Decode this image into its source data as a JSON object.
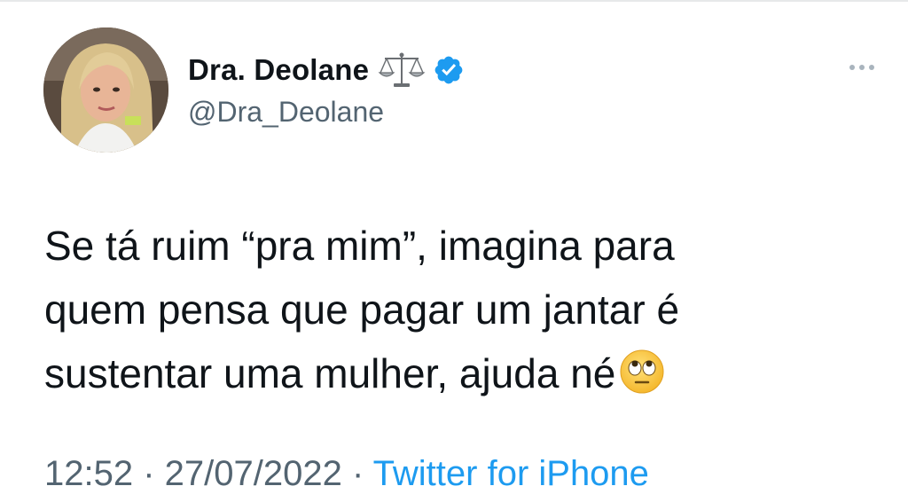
{
  "tweet": {
    "author": {
      "display_name": "Dra. Deolane",
      "handle": "@Dra_Deolane",
      "name_emoji": "⚖️",
      "verified": true,
      "avatar_icon": "profile-photo"
    },
    "text_line_1": "Se tá ruim “pra mim”, imagina para",
    "text_line_2": "quem pensa que pagar um jantar é",
    "text_line_3": "sustentar uma mulher, ajuda né",
    "text_emoji": "🙄",
    "meta": {
      "time_date": "12:52 · 27/07/2022 · ",
      "source": "Twitter for iPhone"
    }
  },
  "icons": {
    "more": "more-horizontal-icon",
    "verified": "verified-badge-icon",
    "scales": "balance-scale-icon"
  },
  "colors": {
    "verified_blue": "#1d9bf0",
    "secondary_text": "#536471",
    "primary_text": "#0f1419"
  }
}
